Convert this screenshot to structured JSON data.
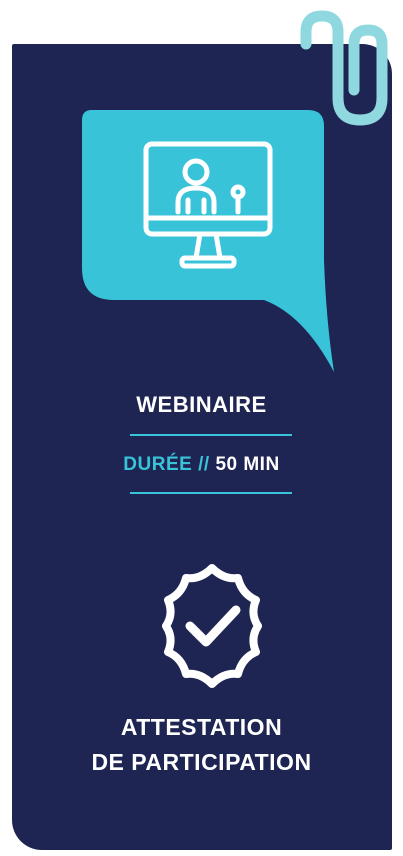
{
  "format_label": "WEBINAIRE",
  "duration": {
    "label": "DURÉE",
    "separator": "//",
    "value": "50 MIN"
  },
  "certificate": {
    "line1": "ATTESTATION",
    "line2": "DE PARTICIPATION"
  },
  "colors": {
    "background": "#1f2552",
    "accent": "#39c3d9",
    "text": "#ffffff"
  },
  "icons": [
    "paperclip-icon",
    "monitor-presenter-icon",
    "verified-badge-icon"
  ]
}
